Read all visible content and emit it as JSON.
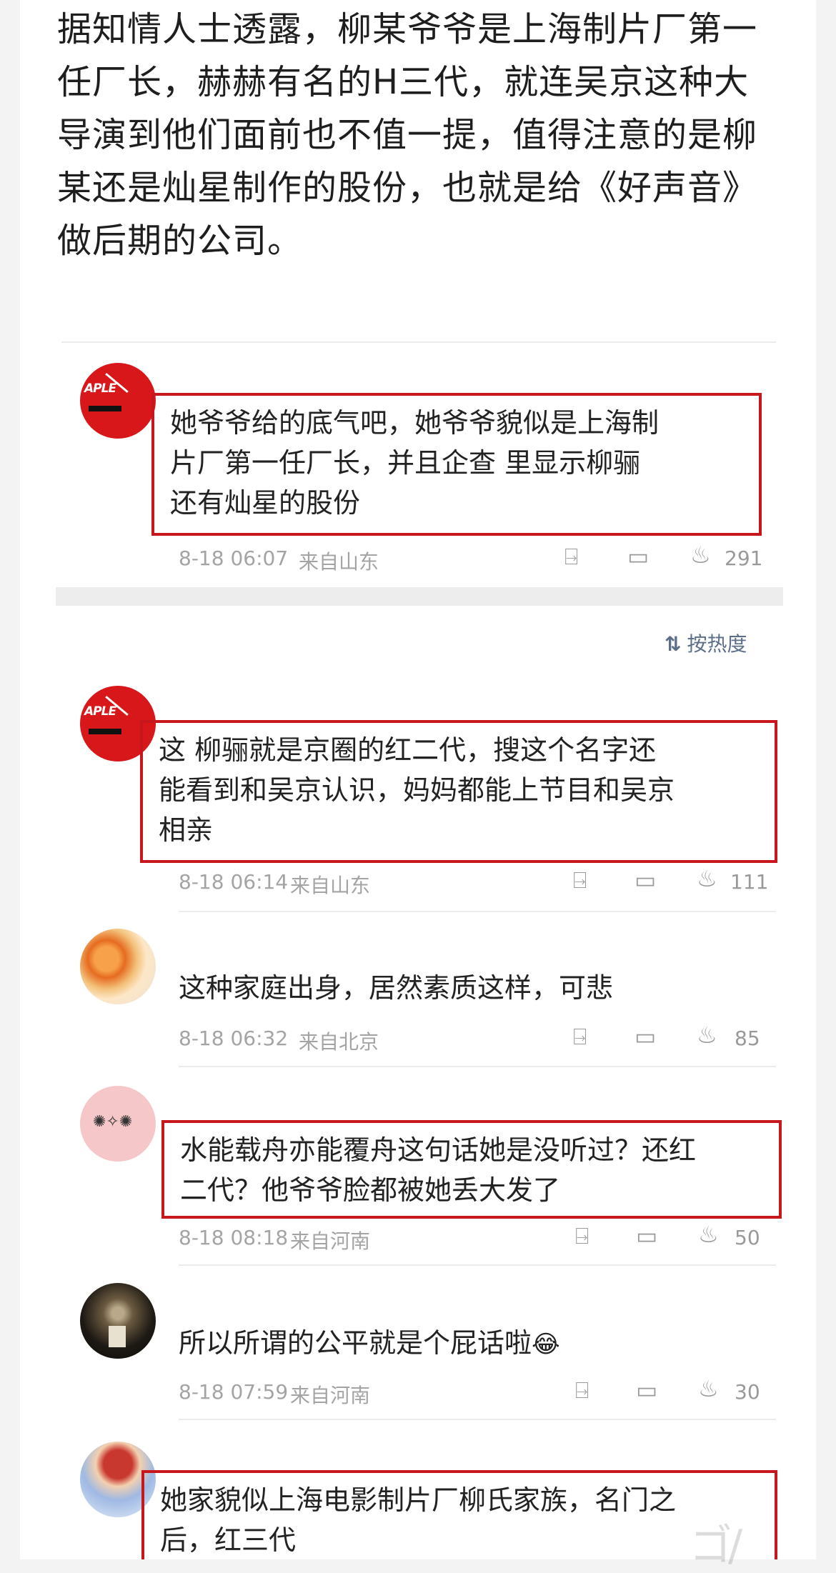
{
  "article": {
    "lines": [
      "据知情人士透露，柳某爷爷是上海制片厂第一",
      "任厂长，赫赫有名的H三代，就连吴京这种大",
      "导演到他们面前也不值一提，值得注意的是柳",
      "某还是灿星制作的股份，也就是给《好声音》",
      "做后期的公司。"
    ]
  },
  "sort_label": "按热度",
  "avatar_brand": "APLE",
  "comments": [
    {
      "lines": [
        "她爷爷给的底气吧，她爷爷貌似是上海制",
        "片厂第一任厂长，并且企查 里显示柳骊",
        "还有灿星的股份"
      ],
      "time": "8-18 06:07",
      "location": "来自山东",
      "likes": "291"
    },
    {
      "lines": [
        "这 柳骊就是京圈的红二代，搜这个名字还",
        "能看到和吴京认识，妈妈都能上节目和吴京",
        "相亲"
      ],
      "time": "8-18 06:14",
      "location": "来自山东",
      "likes": "111"
    },
    {
      "lines": [
        "这种家庭出身，居然素质这样，可悲"
      ],
      "time": "8-18 06:32",
      "location": "来自北京",
      "likes": "85"
    },
    {
      "lines": [
        "水能载舟亦能覆舟这句话她是没听过？还红",
        "二代？他爷爷脸都被她丢大发了"
      ],
      "time": "8-18 08:18",
      "location": "来自河南",
      "likes": "50"
    },
    {
      "lines": [
        "所以所谓的公平就是个屁话啦"
      ],
      "emoji": "😂",
      "time": "8-18 07:59",
      "location": "来自河南",
      "likes": "30"
    },
    {
      "lines": [
        "她家貌似上海电影制片厂柳氏家族，名门之",
        "后，红三代"
      ]
    }
  ]
}
